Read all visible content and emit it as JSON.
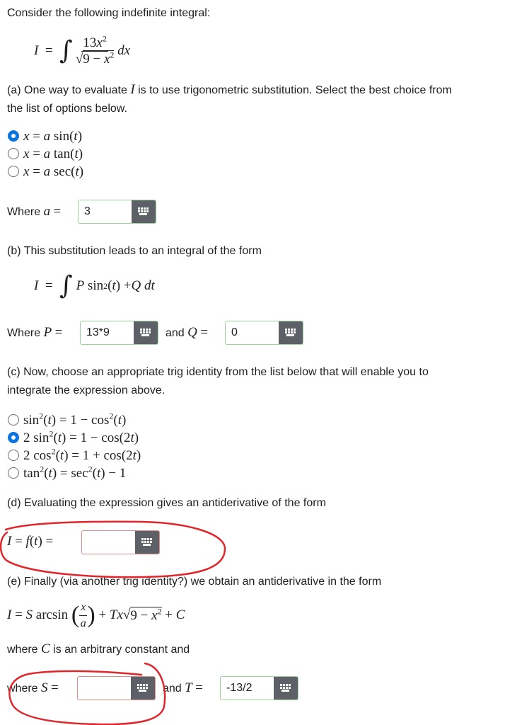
{
  "intro": "Consider the following indefinite integral:",
  "integral": {
    "lhs": "I",
    "num_coef": "13x",
    "num_exp": "2",
    "den": "9 − x",
    "den_exp": "2",
    "dx": "dx"
  },
  "part_a": {
    "prompt_line1": "(a) One way to evaluate ",
    "prompt_var": "I",
    "prompt_line1b": " is to use trigonometric substitution. Select the best choice from",
    "prompt_line2": "the list of options below.",
    "options": [
      "x = a sin(t)",
      "x = a tan(t)",
      "x = a sec(t)"
    ],
    "selected_index": 0,
    "where_label": "Where a =",
    "a_value": "3"
  },
  "part_b": {
    "prompt": "(b) This substitution leads to an integral of the form",
    "form": "I = ∫ P sin²(t) + Q dt",
    "where_label": "Where P =",
    "p_value": "13*9",
    "and_label": "and Q =",
    "q_value": "0"
  },
  "part_c": {
    "prompt_line1": "(c) Now, choose an appropriate trig identity from the list below that will enable you to",
    "prompt_line2": "integrate the expression above.",
    "options": [
      "sin²(t) = 1 − cos²(t)",
      "2 sin²(t) = 1 − cos(2t)",
      "2 cos²(t) = 1 + cos(2t)",
      "tan²(t) = sec²(t) − 1"
    ],
    "selected_index": 1
  },
  "part_d": {
    "prompt": "(d) Evaluating the expression gives an antiderivative of the form",
    "label": "I = f(t) =",
    "value": ""
  },
  "part_e": {
    "prompt": "(e) Finally (via another trig identity?) we obtain an antiderivative in the form",
    "form": "I = S arcsin(x/a) + Tx√(9 − x²) + C",
    "where_line": "where C is an arbitrary constant and",
    "s_label": "where S =",
    "s_value": "",
    "t_label": "and T =",
    "t_value": "-13/2"
  },
  "colors": {
    "accent": "#0b74e0",
    "valid_border": "#9fd19f",
    "invalid_border": "#e08a8a",
    "annotation": "#e0262b"
  }
}
